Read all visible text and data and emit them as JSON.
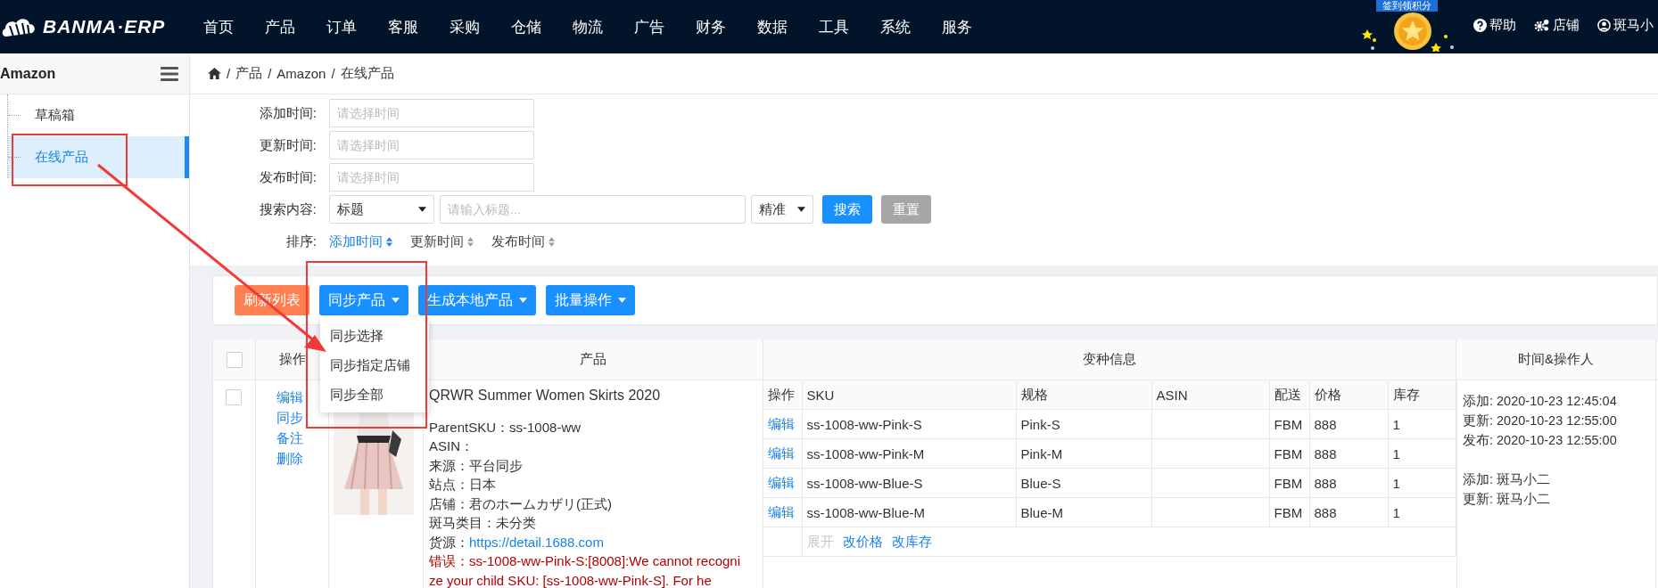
{
  "header": {
    "logo": "BANMA·ERP",
    "nav": [
      "首页",
      "产品",
      "订单",
      "客服",
      "采购",
      "仓储",
      "物流",
      "广告",
      "财务",
      "数据",
      "工具",
      "系统",
      "服务"
    ],
    "promo": "签到领积分",
    "links": [
      {
        "kind": "help",
        "label": "帮助"
      },
      {
        "kind": "store",
        "label": "店铺"
      },
      {
        "kind": "user",
        "label": "斑马小"
      }
    ]
  },
  "sidebar": {
    "title": "Amazon",
    "items": [
      {
        "label": "草稿箱",
        "selected": false
      },
      {
        "label": "在线产品",
        "selected": true
      }
    ]
  },
  "breadcrumb": {
    "separator": "/",
    "items": [
      "产品",
      "Amazon",
      "在线产品"
    ]
  },
  "filters": [
    {
      "kind": "date",
      "label": "添加时间:",
      "placeholder": "请选择时间"
    },
    {
      "kind": "date",
      "label": "更新时间:",
      "placeholder": "请选择时间"
    },
    {
      "kind": "date",
      "label": "发布时间:",
      "placeholder": "请选择时间"
    },
    {
      "kind": "search",
      "label": "搜索内容:",
      "field": "标题",
      "placeholder": "请输入标题...",
      "mode": "精准",
      "buttons": [
        {
          "label": "搜索",
          "kind": "primary"
        },
        {
          "label": "重置",
          "kind": "default"
        }
      ]
    }
  ],
  "sort": {
    "label": "排序:",
    "options": [
      {
        "label": "添加时间",
        "selected": true
      },
      {
        "label": "更新时间",
        "selected": false
      },
      {
        "label": "发布时间",
        "selected": false
      }
    ]
  },
  "toolbar": [
    {
      "label": "刷新列表",
      "kind": "warning",
      "menu": false
    },
    {
      "label": "同步产品",
      "kind": "primary",
      "menu": true,
      "menu_items": [
        "同步选择",
        "同步指定店铺",
        "同步全部"
      ]
    },
    {
      "label": "生成本地产品",
      "kind": "primary",
      "menu": true
    },
    {
      "label": "批量操作",
      "kind": "primary",
      "menu": true
    }
  ],
  "table": {
    "header_checked": false,
    "columns": [
      "操作",
      "产品",
      "变种信息",
      "时间&操作人"
    ],
    "rows": [
      {
        "checked": false,
        "actions": [
          "编辑",
          "同步",
          "备注",
          "删除"
        ],
        "title": "QRWR Summer Women Skirts 2020",
        "details": [
          "ParentSKU：ss-1008-ww",
          "ASIN：",
          "来源：平台同步",
          "站点：日本",
          "店铺：君のホームカザリ(正式)",
          "斑马类目：未分类"
        ],
        "source": {
          "label": "货源：",
          "link": "https://detail.1688.com"
        },
        "error": "错误：ss-1008-ww-Pink-S:[8008]:We cannot recognize your child SKU: [ss-1008-ww-Pink-S]. For he",
        "variant_columns": [
          "操作",
          "SKU",
          "规格",
          "ASIN",
          "配送",
          "价格",
          "库存"
        ],
        "variants": [
          {
            "action": "编辑",
            "sku": "ss-1008-ww-Pink-S",
            "spec": "Pink-S",
            "shipping": "FBM",
            "price": "888",
            "stock": "1"
          },
          {
            "action": "编辑",
            "sku": "ss-1008-ww-Pink-M",
            "spec": "Pink-M",
            "shipping": "FBM",
            "price": "888",
            "stock": "1"
          },
          {
            "action": "编辑",
            "sku": "ss-1008-ww-Blue-S",
            "spec": "Blue-S",
            "shipping": "FBM",
            "price": "888",
            "stock": "1"
          },
          {
            "action": "编辑",
            "sku": "ss-1008-ww-Blue-M",
            "spec": "Blue-M",
            "shipping": "FBM",
            "price": "888",
            "stock": "1"
          }
        ],
        "variant_actions": [
          {
            "label": "展开",
            "disabled": true
          },
          {
            "label": "改价格",
            "disabled": false
          },
          {
            "label": "改库存",
            "disabled": false
          }
        ],
        "times": [
          "添加: 2020-10-23 12:45:04",
          "更新: 2020-10-23 12:55:00",
          "发布: 2020-10-23 12:55:00"
        ],
        "operators": [
          "添加: 斑马小二",
          "更新: 斑马小二"
        ]
      }
    ]
  }
}
